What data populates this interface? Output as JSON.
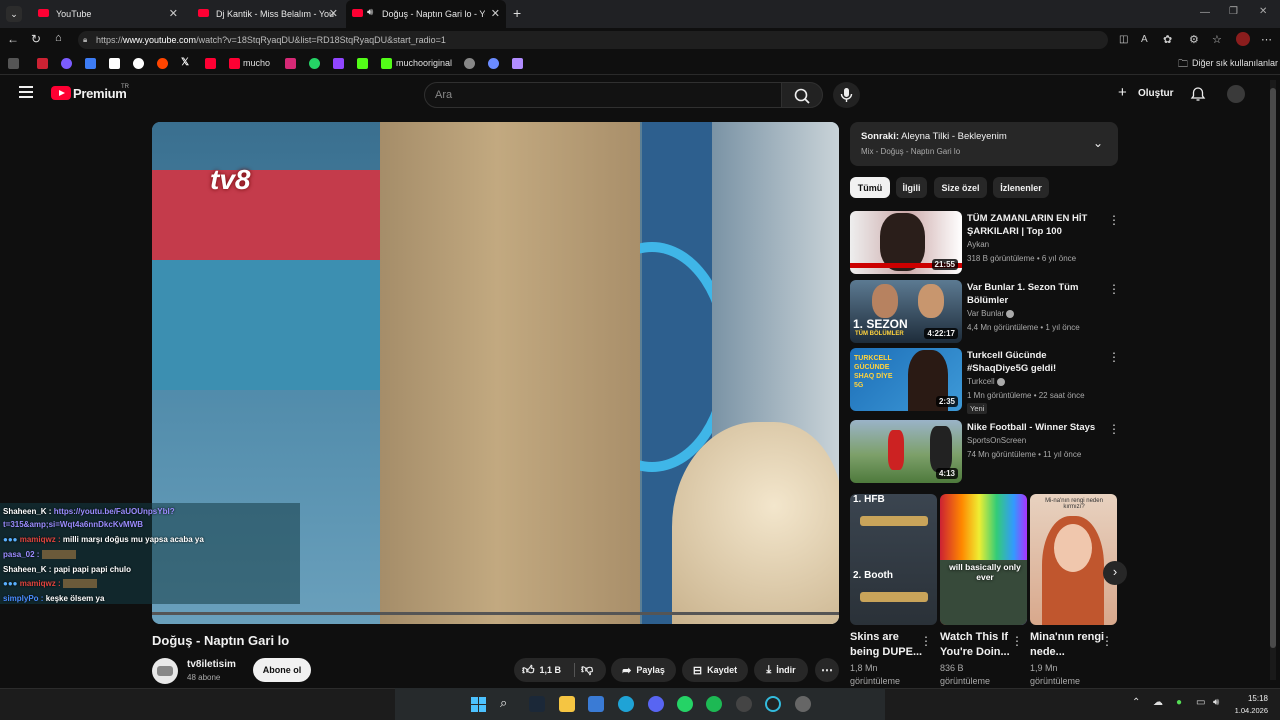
{
  "browser": {
    "tabs": [
      {
        "title": "YouTube",
        "active": false
      },
      {
        "title": "Dj Kantik - Miss Belalım - YouTube",
        "active": false
      },
      {
        "title": "Doğuş - Naptın Gari lo - YouTube",
        "active": true
      }
    ],
    "url_prefix": "https://",
    "url_host": "www.youtube.com",
    "url_rest": "/watch?v=18StqRyaqDU&list=RD18StqRyaqDU&start_radio=1",
    "bookmarks": [
      "mucho",
      "muchooriginal"
    ],
    "other_bookmarks": "Diğer sık kullanılanlar"
  },
  "youtube": {
    "logo": "Premium",
    "logo_sup": "TR",
    "search_placeholder": "Ara",
    "create_label": "Oluştur",
    "video": {
      "overlay_channel_logo": "tv8",
      "title": "Doğuş - Naptın Gari lo",
      "channel": "tv8iletisim",
      "subscribers": "48 abone",
      "subscribe_label": "Abone ol",
      "likes": "1,1 B",
      "share_label": "Paylaş",
      "save_label": "Kaydet",
      "download_label": "İndir"
    },
    "up_next": {
      "prefix": "Sonraki:",
      "title": "Aleyna Tilki - Bekleyenim",
      "sub": "Mix - Doğuş - Naptın Gari lo"
    },
    "chips": [
      "Tümü",
      "İlgili",
      "Size özel",
      "İzlenenler"
    ],
    "recommendations": [
      {
        "title": "TÜM ZAMANLARIN EN HİT ŞARKILARI | Top 100",
        "channel": "Aykan",
        "meta": "318 B görüntüleme • 6 yıl önce",
        "duration": "21:55",
        "verified": false,
        "badge": ""
      },
      {
        "title": "Var Bunlar 1. Sezon Tüm Bölümler",
        "channel": "Var Bunlar",
        "meta": "4,4 Mn görüntüleme • 1 yıl önce",
        "duration": "4:22:17",
        "verified": true,
        "badge": "",
        "thumb_text": "1. SEZON",
        "thumb_sub": "TÜM BÖLÜMLER"
      },
      {
        "title": "Turkcell Gücünde #ShaqDiye5G geldi!",
        "channel": "Turkcell",
        "meta": "1 Mn görüntüleme • 22 saat önce",
        "duration": "2:35",
        "verified": true,
        "badge": "Yeni",
        "thumb_text": "TURKCELL GÜCÜNDE SHAQ DİYE 5G"
      },
      {
        "title": "Nike Football - Winner Stays",
        "channel": "SportsOnScreen",
        "meta": "74 Mn görüntüleme • 11 yıl önce",
        "duration": "4:13",
        "verified": false,
        "badge": ""
      }
    ],
    "shorts": [
      {
        "title": "Skins are being DUPE...",
        "views": "1,8 Mn",
        "views_label": "görüntüleme",
        "thumb_top": "1. HFB",
        "thumb_bottom": "2. Booth"
      },
      {
        "title": "Watch This If You're Doin...",
        "views": "836 B",
        "views_label": "görüntüleme",
        "thumb_caption": "will basically only ever"
      },
      {
        "title": "Mina'nın rengi nede...",
        "views": "1,9 Mn",
        "views_label": "görüntüleme",
        "thumb_caption": "Mi-na'nın rengi neden kırmızı?"
      }
    ]
  },
  "chat": [
    {
      "user": "Shaheen_K :",
      "text": "https://youtu.be/FaUOUnpsYbl?",
      "user_color": "#ffffff",
      "text_color": "#9b8cff"
    },
    {
      "user": "",
      "text": "t=315&amp;si=Wqt4a6nnDkcKvMWB",
      "user_color": "#ffffff",
      "text_color": "#9b8cff"
    },
    {
      "user": "mamiqwz :",
      "text": "milli marşı doğus mu yapsa acaba ya",
      "user_color": "#e0443e",
      "text_color": "#ffffff"
    },
    {
      "user": "pasa_02 :",
      "text": "",
      "user_color": "#9b8cff",
      "text_color": "#ffffff"
    },
    {
      "user": "Shaheen_K :",
      "text": "papi papi papi chulo",
      "user_color": "#ffffff",
      "text_color": "#ffffff"
    },
    {
      "user": "mamiqwz :",
      "text": "",
      "user_color": "#e0443e",
      "text_color": "#ffffff"
    },
    {
      "user": "simplyPo :",
      "text": "keşke ölsem ya",
      "user_color": "#4a8cff",
      "text_color": "#ffffff"
    }
  ],
  "taskbar": {
    "time": "15:18",
    "date": "1.04.2026"
  },
  "colors": {
    "accent": "#ff0033",
    "bg": "#0f0f0f",
    "chip_bg": "#272727"
  }
}
